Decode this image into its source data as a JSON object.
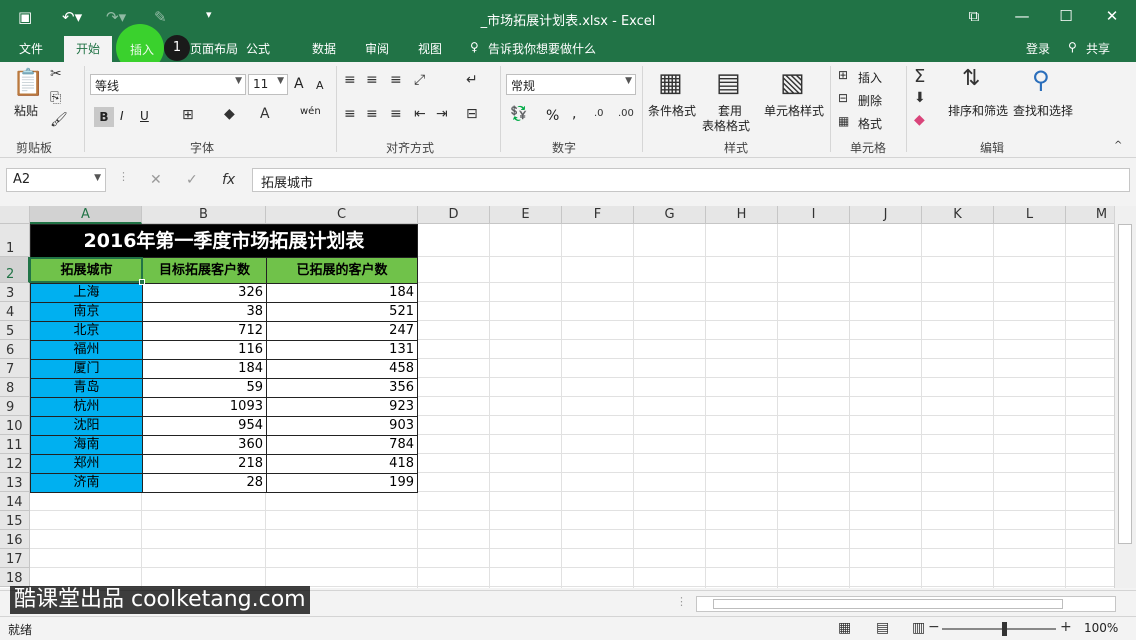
{
  "window": {
    "title": "_市场拓展计划表.xlsx - Excel"
  },
  "tabs": [
    "文件",
    "开始",
    "插入",
    "页面布局",
    "公式",
    "数据",
    "审阅",
    "视图"
  ],
  "active_tab": "开始",
  "tell_me": "告诉我你想要做什么",
  "account": {
    "login": "登录",
    "share": "共享"
  },
  "step_badge": "1",
  "ribbon": {
    "clipboard": {
      "paste": "粘贴",
      "label": "剪贴板"
    },
    "font": {
      "name": "等线",
      "size": "11",
      "label": "字体",
      "bold": "B",
      "italic": "I",
      "underline": "U",
      "grow": "A",
      "shrink": "A",
      "wen": "wén"
    },
    "alignment": {
      "label": "对齐方式"
    },
    "number": {
      "format": "常规",
      "percent": "%",
      "comma": ",",
      "label": "数字"
    },
    "styles": {
      "conditional": "条件格式",
      "table_line1": "套用",
      "table_line2": "表格格式",
      "cell_styles": "单元格样式",
      "label": "样式"
    },
    "cells": {
      "insert": "插入",
      "delete": "删除",
      "format": "格式",
      "label": "单元格"
    },
    "editing": {
      "sort_filter": "排序和筛选",
      "find_select": "查找和选择",
      "label": "编辑"
    }
  },
  "name_box": "A2",
  "formula": "拓展城市",
  "columns": [
    "A",
    "B",
    "C",
    "D",
    "E",
    "F",
    "G",
    "H",
    "I",
    "J",
    "K",
    "L",
    "M"
  ],
  "rows": [
    "1",
    "2",
    "3",
    "4",
    "5",
    "6",
    "7",
    "8",
    "9",
    "10",
    "11",
    "12",
    "13",
    "14",
    "15",
    "16",
    "17",
    "18"
  ],
  "sheet": {
    "title": "2016年第一季度市场拓展计划表",
    "headers": [
      "拓展城市",
      "目标拓展客户数",
      "已拓展的客户数"
    ],
    "data": [
      [
        "上海",
        "326",
        "184"
      ],
      [
        "南京",
        "38",
        "521"
      ],
      [
        "北京",
        "712",
        "247"
      ],
      [
        "福州",
        "116",
        "131"
      ],
      [
        "厦门",
        "184",
        "458"
      ],
      [
        "青岛",
        "59",
        "356"
      ],
      [
        "杭州",
        "1093",
        "923"
      ],
      [
        "沈阳",
        "954",
        "903"
      ],
      [
        "海南",
        "360",
        "784"
      ],
      [
        "郑州",
        "218",
        "418"
      ],
      [
        "济南",
        "28",
        "199"
      ]
    ]
  },
  "watermark": "酷课堂出品 coolketang.com",
  "status": {
    "text": "就绪",
    "zoom": "100%"
  },
  "colors": {
    "excel_green": "#217346",
    "header_green": "#70c24a",
    "city_blue": "#00b0f0",
    "click_circle": "#3ad12d"
  }
}
